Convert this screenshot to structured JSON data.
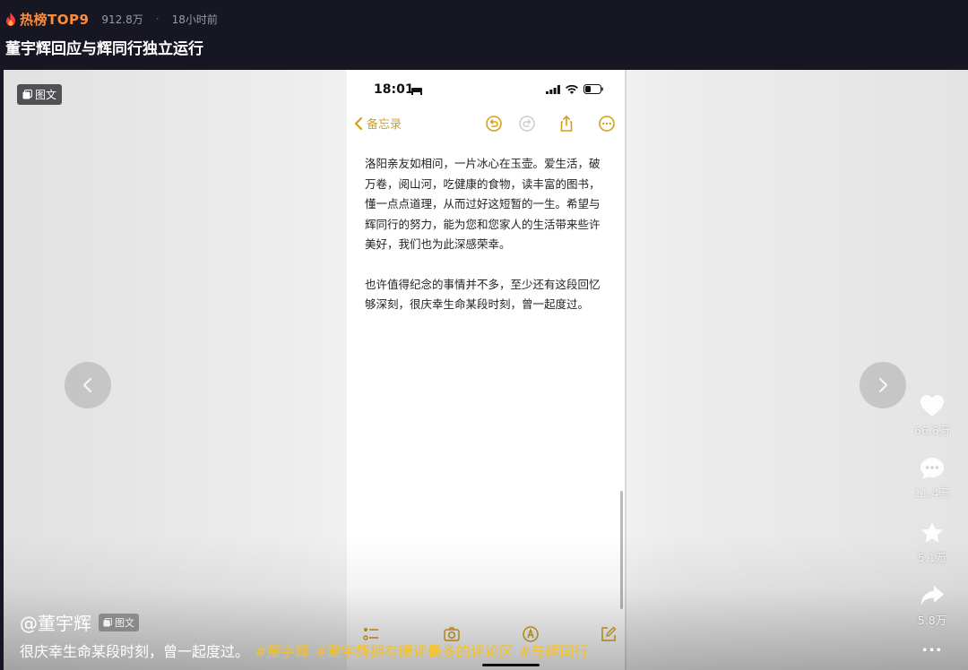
{
  "header": {
    "hot_label": "热榜TOP9",
    "views": "912.8万",
    "separator": "·",
    "time": "18小时前",
    "title": "董宇辉回应与辉同行独立运行"
  },
  "media": {
    "type_badge": "图文",
    "phone": {
      "clock": "18:01",
      "back_label": "备忘录",
      "paragraphs": [
        "洛阳亲友如相问，一片冰心在玉壶。爱生活，破万卷，阅山河，吃健康的食物，读丰富的图书，懂一点点道理，从而过好这短暂的一生。希望与辉同行的努力，能为您和您家人的生活带来些许美好，我们也为此深感荣幸。",
        "也许值得纪念的事情并不多，至少还有这段回忆够深刻，很庆幸生命某段时刻，曾一起度过。"
      ]
    }
  },
  "actions": {
    "likes": "66.6万",
    "comments": "11.4万",
    "favorites": "5.1万",
    "shares": "5.8万",
    "more": "..."
  },
  "post": {
    "author": "@董宇辉",
    "type_chip": "图文",
    "caption": "很庆幸生命某段时刻，曾一起度过。",
    "hashtags": [
      "#董宇辉",
      "#董宇辉拥有暖评最多的评论区",
      "#与辉同行"
    ]
  },
  "colors": {
    "accent_orange": "#fe8c3a",
    "hashtag_yellow": "#f5c125",
    "notes_yellow": "#d4a017",
    "background": "#161722"
  }
}
